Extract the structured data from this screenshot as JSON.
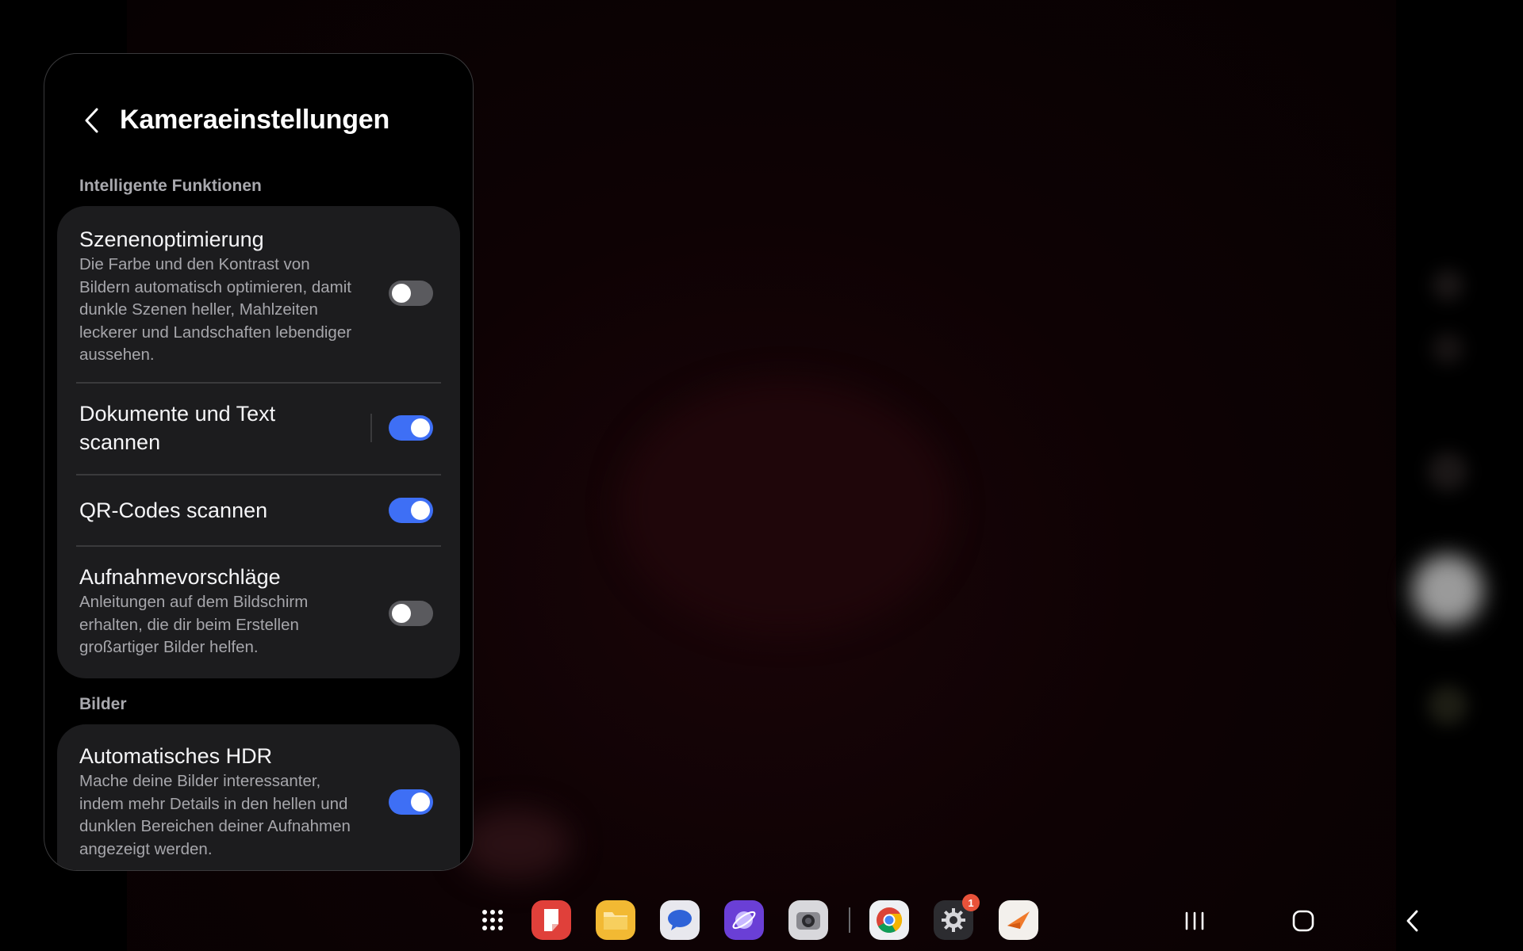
{
  "settings": {
    "title": "Kameraeinstellungen",
    "sections": [
      {
        "label": "Intelligente Funktionen",
        "items": [
          {
            "title": "Szenenoptimierung",
            "description": "Die Farbe und den Kontrast von Bildern automatisch optimieren, damit dunkle Szenen heller, Mahlzeiten leckerer und Landschaften lebendiger aussehen.",
            "enabled": false
          },
          {
            "title": "Dokumente und Text scannen",
            "enabled": true
          },
          {
            "title": "QR-Codes scannen",
            "enabled": true
          },
          {
            "title": "Aufnahmevorschläge",
            "description": "Anleitungen auf dem Bildschirm erhalten, die dir beim Erstellen großartiger Bilder helfen.",
            "enabled": false
          }
        ]
      },
      {
        "label": "Bilder",
        "items": [
          {
            "title": "Automatisches HDR",
            "description": "Mache deine Bilder interessanter, indem mehr Details in den hellen und dunklen Bereichen deiner Aufnahmen angezeigt werden.",
            "enabled": true
          }
        ]
      }
    ]
  },
  "taskbar": {
    "apps": [
      {
        "icon": "app-drawer-icon"
      },
      {
        "icon": "notes-app-icon",
        "color": "#e0403a"
      },
      {
        "icon": "my-files-icon",
        "color": "#f2b933"
      },
      {
        "icon": "messages-icon",
        "color": "#e8e8ee"
      },
      {
        "icon": "internet-browser-icon",
        "color": "#6a3fd6"
      },
      {
        "icon": "camera-icon",
        "color": "#d8d8dc"
      },
      {
        "icon": "chrome-icon"
      },
      {
        "icon": "settings-icon",
        "badge": "1"
      },
      {
        "icon": "swiftkey-app-icon",
        "color": "#f3f0ec"
      }
    ],
    "nav": [
      "recents-icon",
      "home-icon",
      "back-icon"
    ]
  },
  "colors": {
    "toggle_on": "#3e6ff5",
    "toggle_off": "#5a5a5e",
    "card": "#1c1c1e",
    "badge": "#e8523a"
  }
}
